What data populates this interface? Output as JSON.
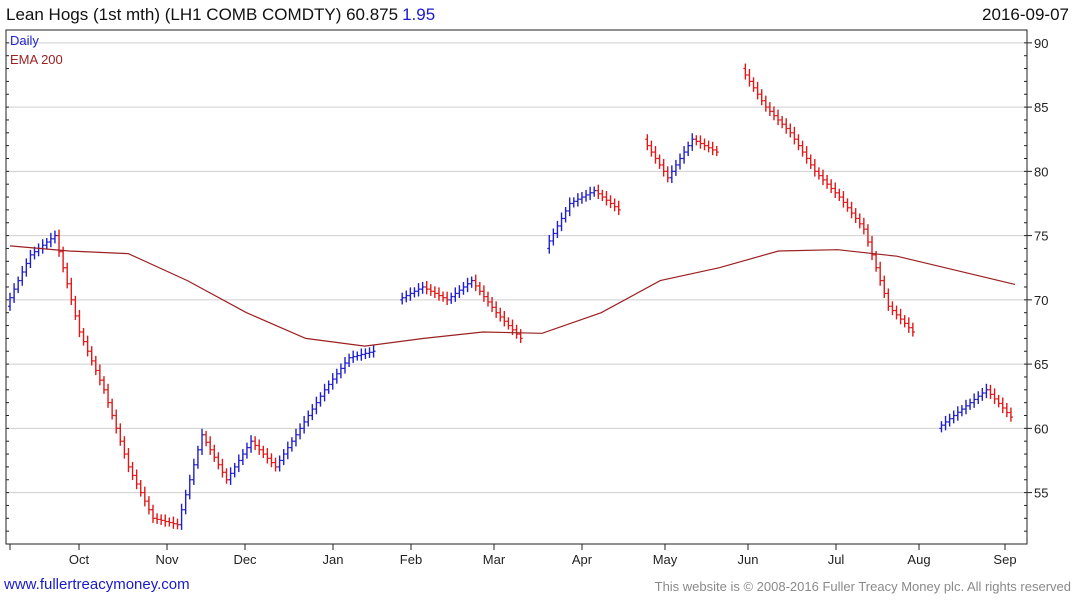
{
  "header": {
    "title": "Lean Hogs (1st mth)  (LH1 COMB COMDTY) 60.875",
    "change": "1.95",
    "date": "2016-09-07"
  },
  "footer": {
    "left": "www.fullertreacymoney.com",
    "right": "This website is © 2008-2016 Fuller Treacy Money plc. All rights reserved"
  },
  "colors": {
    "up": "#1f1fd0",
    "down": "#e01818",
    "ema": "#9b2020",
    "grid": "#cfcfcf",
    "axis": "#222222",
    "footer_link": "#1a1acc"
  },
  "chart_data": {
    "type": "line",
    "series": [
      {
        "name": "Daily",
        "color": "#1f1fd0",
        "points": [
          [
            "Sep",
            69.5
          ],
          [
            "Oct",
            73.5
          ],
          [
            "Oct",
            75.0
          ],
          [
            "Oct",
            67.5
          ],
          [
            "Nov",
            63.0
          ],
          [
            "Nov",
            57.0
          ],
          [
            "Nov",
            53.0
          ],
          [
            "Nov",
            52.5
          ],
          [
            "Dec",
            59.5
          ],
          [
            "Dec",
            56.0
          ],
          [
            "Dec",
            59.0
          ],
          [
            "Jan",
            57.0
          ],
          [
            "Jan",
            60.0
          ],
          [
            "Jan",
            63.0
          ],
          [
            "Feb",
            65.5
          ],
          [
            "Feb",
            66.0
          ],
          [
            "Feb",
            70.0
          ],
          [
            "Mar",
            71.0
          ],
          [
            "Mar",
            70.0
          ],
          [
            "Mar",
            71.5
          ],
          [
            "Apr",
            69.0
          ],
          [
            "Apr",
            67.0
          ],
          [
            "Apr",
            74.0
          ],
          [
            "May",
            77.5
          ],
          [
            "May",
            78.5
          ],
          [
            "May",
            77.0
          ],
          [
            "May",
            82.5
          ],
          [
            "Jun",
            79.5
          ],
          [
            "Jun",
            82.5
          ],
          [
            "Jun",
            81.5
          ],
          [
            "Jun",
            88.0
          ],
          [
            "Jun",
            85.0
          ],
          [
            "Jul",
            83.0
          ],
          [
            "Jul",
            80.0
          ],
          [
            "Jul",
            78.0
          ],
          [
            "Jul",
            75.5
          ],
          [
            "Aug",
            69.5
          ],
          [
            "Aug",
            67.5
          ],
          [
            "Aug",
            60.0
          ],
          [
            "Aug",
            61.5
          ],
          [
            "Sep",
            63.0
          ],
          [
            "Sep",
            60.875
          ]
        ]
      },
      {
        "name": "EMA 200",
        "color": "#9b2020",
        "points": [
          [
            "Sep",
            74.2
          ],
          [
            "Oct",
            73.8
          ],
          [
            "Oct",
            73.6
          ],
          [
            "Nov",
            71.5
          ],
          [
            "Dec",
            69.0
          ],
          [
            "Jan",
            67.0
          ],
          [
            "Feb",
            66.4
          ],
          [
            "Mar",
            67.0
          ],
          [
            "Apr",
            67.5
          ],
          [
            "Apr",
            67.4
          ],
          [
            "May",
            69.0
          ],
          [
            "Jun",
            71.5
          ],
          [
            "Jun",
            72.5
          ],
          [
            "Jul",
            73.8
          ],
          [
            "Jul",
            73.9
          ],
          [
            "Aug",
            73.4
          ],
          [
            "Aug",
            72.3
          ],
          [
            "Sep",
            71.2
          ]
        ]
      }
    ],
    "x_ticks": [
      "Oct",
      "Nov",
      "Dec",
      "Jan",
      "Feb",
      "Mar",
      "Apr",
      "May",
      "Jun",
      "Jul",
      "Aug",
      "Sep"
    ],
    "y_ticks": [
      55,
      60,
      65,
      70,
      75,
      80,
      85,
      90
    ],
    "ylim": [
      51,
      91
    ],
    "legend": [
      "Daily",
      "EMA 200"
    ],
    "legend_position": "top-left",
    "grid": true,
    "y_axis_side": "right"
  }
}
